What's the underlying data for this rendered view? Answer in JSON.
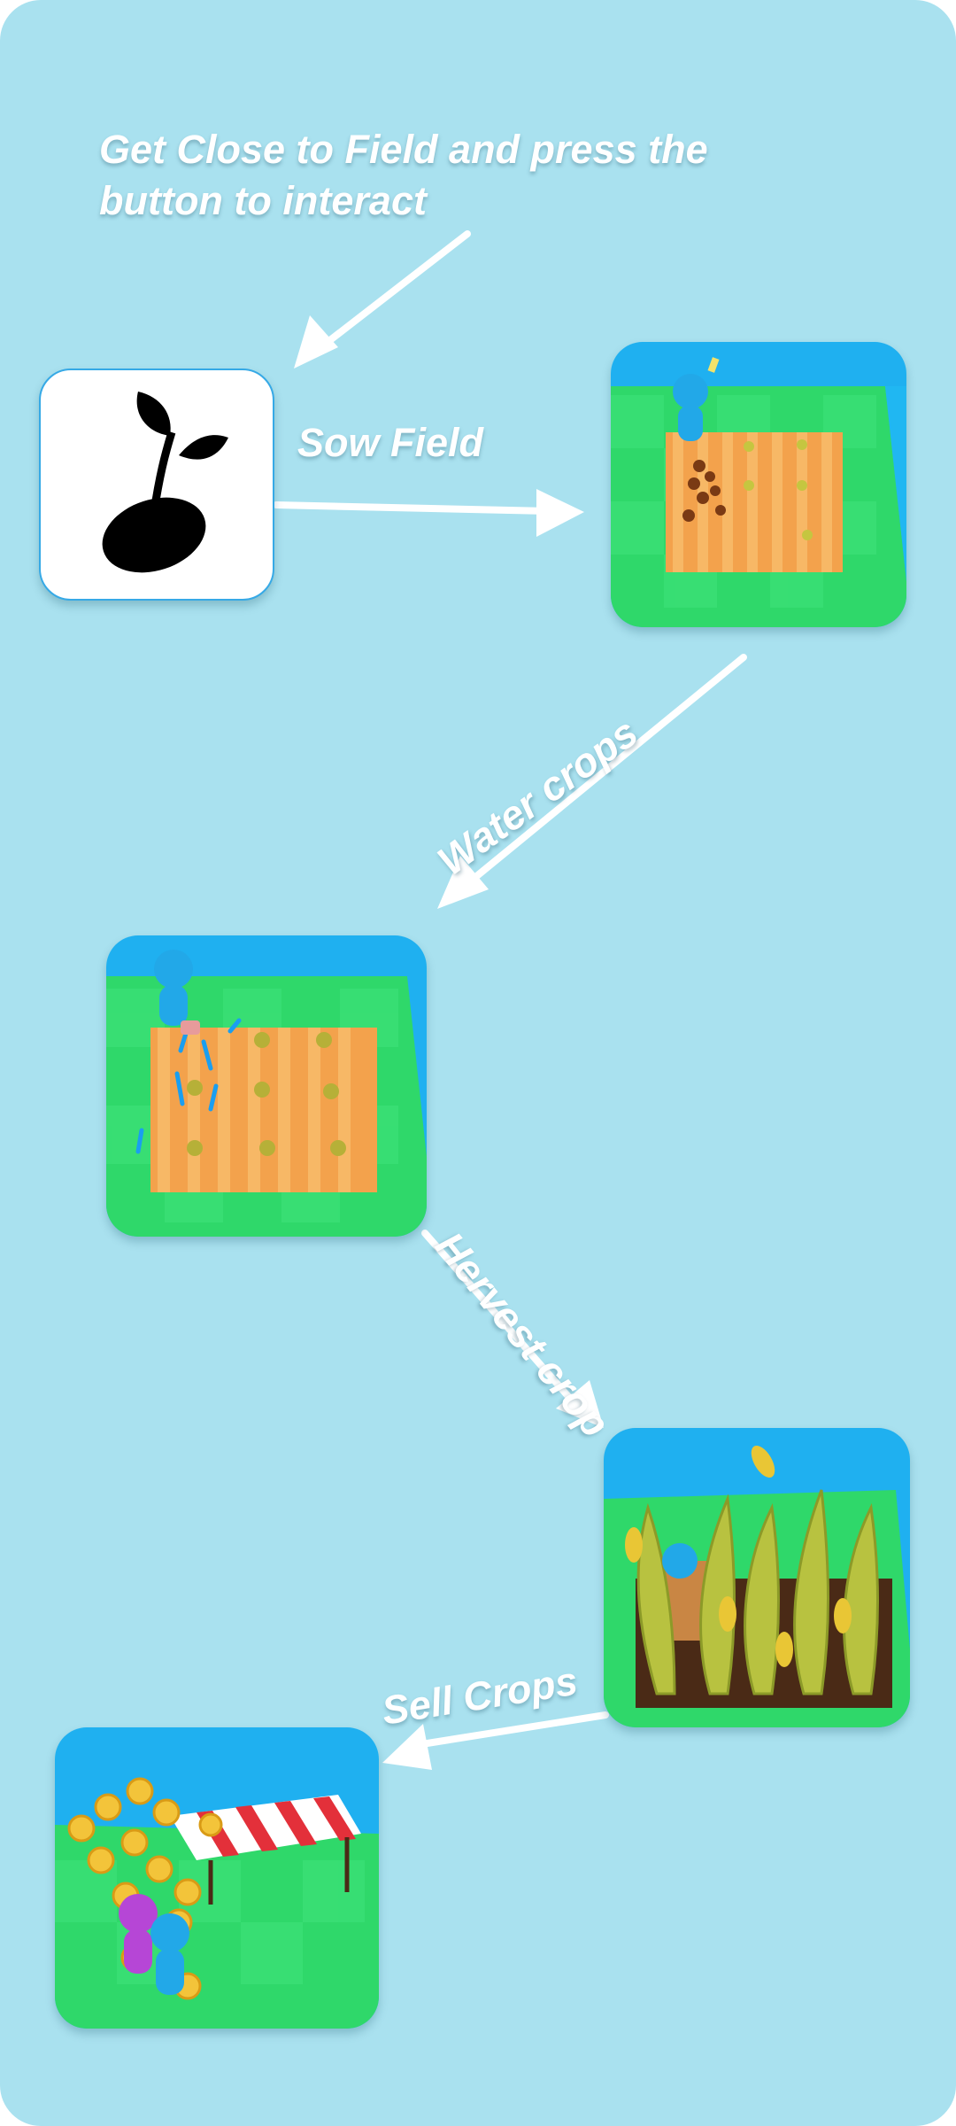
{
  "instructions": {
    "intro": "Get Close to Field and press the button to interact"
  },
  "steps": [
    {
      "label": "Sow Field"
    },
    {
      "label": "Water crops"
    },
    {
      "label": "Hervest crop"
    },
    {
      "label": "Sell Crops"
    }
  ],
  "icons": {
    "seed": "sprout-icon"
  },
  "colors": {
    "background": "#a9e1ef",
    "label": "#ffffff",
    "arrow": "#ffffff",
    "sky": "#1fb0f0",
    "grass": "#2fd86a",
    "soil": "#f3a24c"
  }
}
